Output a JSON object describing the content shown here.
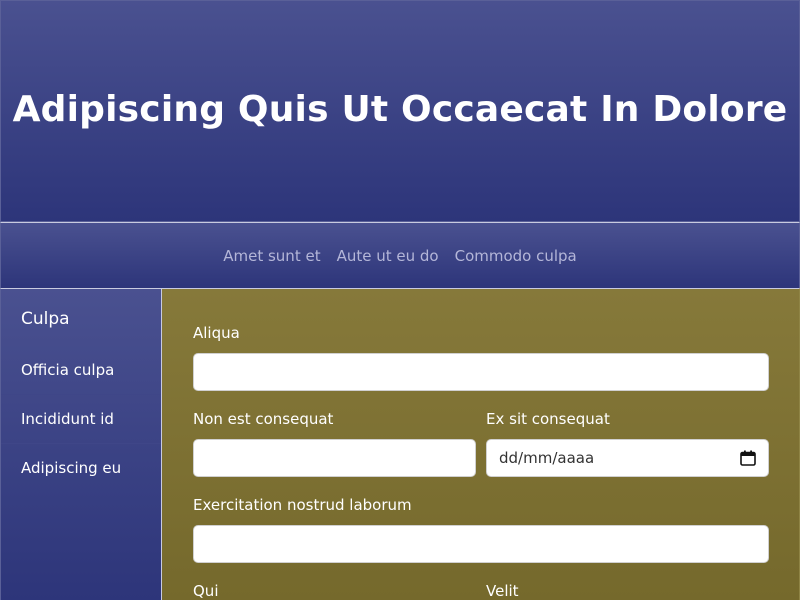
{
  "header": {
    "title": "Adipiscing Quis Ut Occaecat In Dolore"
  },
  "nav": {
    "items": [
      "Amet sunt et",
      "Aute ut eu do",
      "Commodo culpa"
    ]
  },
  "sidebar": {
    "title": "Culpa",
    "items": [
      "Officia culpa",
      "Incididunt id",
      "Adipiscing eu"
    ]
  },
  "form": {
    "field1_label": "Aliqua",
    "field1_value": "",
    "field2_label": "Non est consequat",
    "field2_value": "",
    "field3_label": "Ex sit consequat",
    "field3_placeholder": "dd/mm/aaaa",
    "field4_label": "Exercitation nostrud laborum",
    "field4_value": "",
    "field5_label": "Qui",
    "field6_label": "Velit"
  },
  "colors": {
    "header_bg": "#3b4286",
    "content_bg": "#807437",
    "nav_link": "#b4b6d8"
  },
  "icons": {
    "date_field": "calendar-icon"
  }
}
